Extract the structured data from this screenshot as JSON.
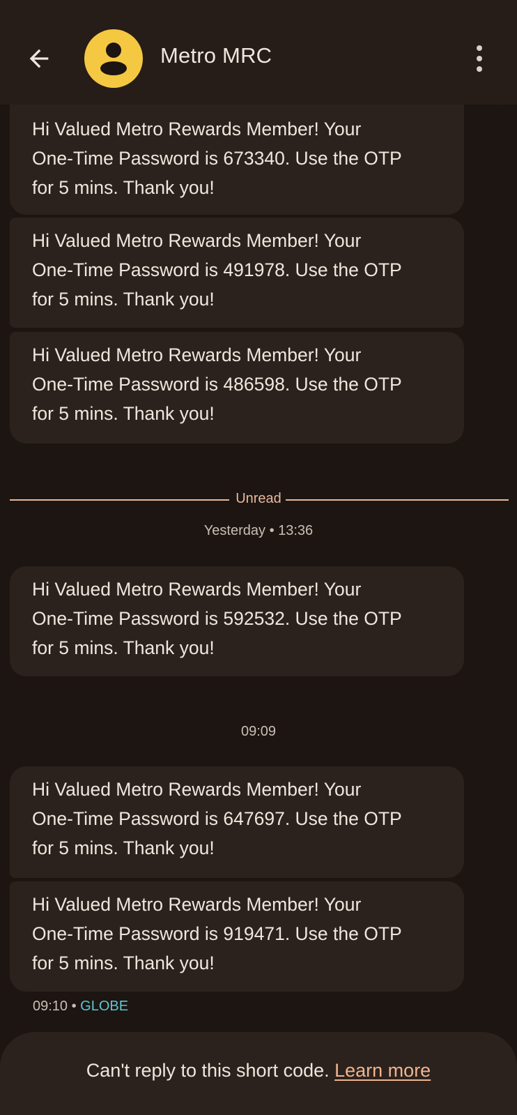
{
  "header": {
    "title": "Metro MRC",
    "back_icon": "arrow-back-icon",
    "avatar_icon": "person-icon",
    "more_icon": "more-vert-icon",
    "avatar_color": "#f5c842"
  },
  "messages": [
    {
      "line1": "Hi Valued Metro Rewards Member! Your",
      "line2": "One-Time Password is 673340. Use the OTP",
      "line3": "for 5 mins. Thank you!"
    },
    {
      "line1": "Hi Valued Metro Rewards Member! Your",
      "line2": "One-Time Password is 491978. Use the OTP",
      "line3": "for 5 mins. Thank you!"
    },
    {
      "line1": "Hi Valued Metro Rewards Member! Your",
      "line2": "One-Time Password is 486598. Use the OTP",
      "line3": "for 5 mins. Thank you!"
    },
    {
      "line1": "Hi Valued Metro Rewards Member! Your",
      "line2": "One-Time Password is 592532. Use the OTP",
      "line3": "for 5 mins. Thank you!"
    },
    {
      "line1": "Hi Valued Metro Rewards Member! Your",
      "line2": "One-Time Password is 647697. Use the OTP",
      "line3": "for 5 mins. Thank you!"
    },
    {
      "line1": "Hi Valued Metro Rewards Member! Your",
      "line2": "One-Time Password is 919471. Use the OTP",
      "line3": "for 5 mins. Thank you!"
    }
  ],
  "divider": {
    "label": "Unread",
    "accent": "#e8b89c"
  },
  "timestamps": {
    "yesterday": "Yesterday • 13:36",
    "today": "09:09"
  },
  "last_meta": {
    "time": "09:10 • ",
    "carrier": "GLOBE",
    "carrier_color": "#5cc6d6"
  },
  "footer": {
    "text": "Can't reply to this short code. ",
    "link": "Learn more"
  }
}
